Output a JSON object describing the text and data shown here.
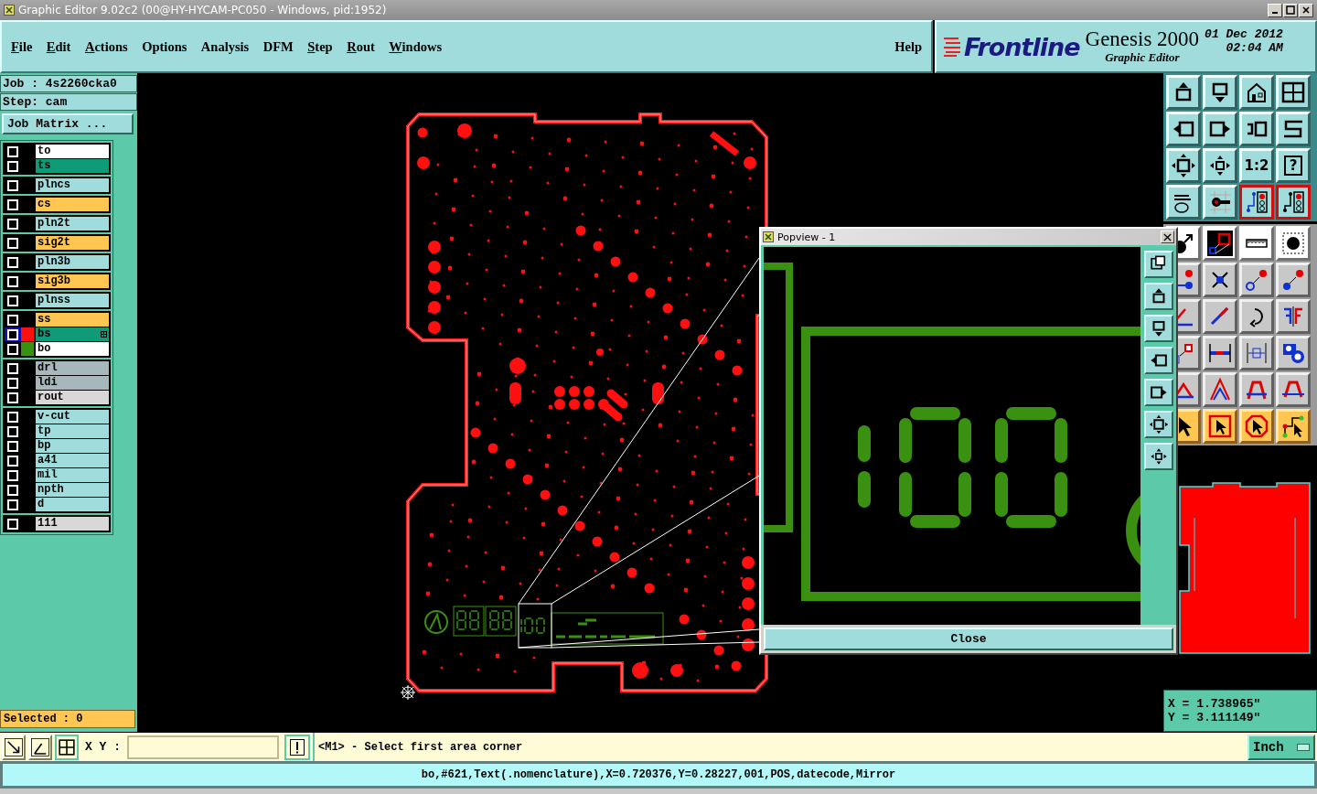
{
  "window": {
    "title": "Graphic Editor 9.02c2 (00@HY-HYCAM-PC050 - Windows, pid:1952)"
  },
  "menu": [
    {
      "label": "File",
      "underlined": true
    },
    {
      "label": "Edit",
      "underlined": true
    },
    {
      "label": "Actions",
      "underlined": true
    },
    {
      "label": "Options",
      "underlined": false
    },
    {
      "label": "Analysis",
      "underlined": false
    },
    {
      "label": "DFM",
      "underlined": false
    },
    {
      "label": "Step",
      "underlined": true
    },
    {
      "label": "Rout",
      "underlined": true
    },
    {
      "label": "Windows",
      "underlined": true
    }
  ],
  "help": "Help",
  "brand": {
    "logo": "Frontline",
    "product": "Genesis 2000",
    "subtitle": "Graphic Editor",
    "date": "01 Dec 2012",
    "time": "02:04 AM"
  },
  "job": {
    "job": "Job : 4s2260cka0",
    "step": "Step: cam",
    "matrix_button": "Job Matrix ..."
  },
  "layer_groups": [
    [
      {
        "name": "to",
        "color": "#ffffff",
        "checked": false,
        "selected": false
      },
      {
        "name": "ts",
        "color": "#0f9a78",
        "checked": false,
        "selected": false
      }
    ],
    [
      {
        "name": "plncs",
        "color": "#a0dcdc",
        "checked": false,
        "selected": false
      }
    ],
    [
      {
        "name": "cs",
        "color": "#ffc651",
        "checked": false,
        "selected": false
      }
    ],
    [
      {
        "name": "pln2t",
        "color": "#a0dcdc",
        "checked": false,
        "selected": false
      }
    ],
    [
      {
        "name": "sig2t",
        "color": "#ffc651",
        "checked": false,
        "selected": false
      }
    ],
    [
      {
        "name": "pln3b",
        "color": "#a0dcdc",
        "checked": false,
        "selected": false
      }
    ],
    [
      {
        "name": "sig3b",
        "color": "#ffc651",
        "checked": false,
        "selected": false
      }
    ],
    [
      {
        "name": "plnss",
        "color": "#a0dcdc",
        "checked": false,
        "selected": false
      }
    ],
    [
      {
        "name": "ss",
        "color": "#ffc651",
        "checked": false,
        "selected": false
      },
      {
        "name": "bs",
        "color": "#0f9a78",
        "checked": false,
        "selected": true,
        "swatch": {
          "color": "#ff1010"
        }
      },
      {
        "name": "bo",
        "color": "#ffffff",
        "checked": false,
        "selected": false,
        "swatch": {
          "color": "#3a9010"
        }
      }
    ],
    [
      {
        "name": "drl",
        "color": "#a6b8bc",
        "checked": false,
        "selected": false
      },
      {
        "name": "ldi",
        "color": "#a6b8bc",
        "checked": false,
        "selected": false
      },
      {
        "name": "rout",
        "color": "#d8d8d8",
        "checked": false,
        "selected": false
      }
    ],
    [
      {
        "name": "v-cut",
        "color": "#a0dcdc",
        "checked": false,
        "selected": false
      },
      {
        "name": "tp",
        "color": "#a0dcdc",
        "checked": false,
        "selected": false
      },
      {
        "name": "bp",
        "color": "#a0dcdc",
        "checked": false,
        "selected": false
      },
      {
        "name": "a41",
        "color": "#a0dcdc",
        "checked": false,
        "selected": false
      },
      {
        "name": "mil",
        "color": "#a0dcdc",
        "checked": false,
        "selected": false
      },
      {
        "name": "npth",
        "color": "#a0dcdc",
        "checked": false,
        "selected": false
      },
      {
        "name": "d",
        "color": "#a0dcdc",
        "checked": false,
        "selected": false
      }
    ],
    [
      {
        "name": "111",
        "color": "#d8d8d8",
        "checked": false,
        "selected": false
      }
    ]
  ],
  "selected_count": "Selected : 0",
  "tools": [
    {
      "kind": "view",
      "on": false
    },
    {
      "kind": "view",
      "on": false
    },
    {
      "kind": "view",
      "on": false
    },
    {
      "kind": "view",
      "on": false
    },
    {
      "kind": "view",
      "on": false
    },
    {
      "kind": "view",
      "on": false
    },
    {
      "kind": "view",
      "on": false
    },
    {
      "kind": "view",
      "on": false
    },
    {
      "kind": "view",
      "on": false
    },
    {
      "kind": "view",
      "on": false
    },
    {
      "kind": "view",
      "on": false,
      "label": "1:2"
    },
    {
      "kind": "view",
      "on": false,
      "label": "?"
    },
    {
      "kind": "view",
      "on": false
    },
    {
      "kind": "view",
      "on": false
    },
    {
      "kind": "view",
      "on": true
    },
    {
      "kind": "view",
      "on": true
    },
    {
      "kind": "display",
      "on": false
    },
    {
      "kind": "display",
      "on": false
    },
    {
      "kind": "display",
      "on": false
    },
    {
      "kind": "display",
      "on": false
    },
    {
      "kind": "edit",
      "on": false
    },
    {
      "kind": "edit",
      "on": false
    },
    {
      "kind": "edit",
      "on": false
    },
    {
      "kind": "edit",
      "on": false
    },
    {
      "kind": "edit",
      "on": false
    },
    {
      "kind": "edit",
      "on": false
    },
    {
      "kind": "edit",
      "on": false
    },
    {
      "kind": "edit",
      "on": false
    },
    {
      "kind": "edit",
      "on": false
    },
    {
      "kind": "edit",
      "on": false
    },
    {
      "kind": "edit",
      "on": false
    },
    {
      "kind": "edit",
      "on": false
    },
    {
      "kind": "edit",
      "on": false
    },
    {
      "kind": "edit",
      "on": false
    },
    {
      "kind": "edit",
      "on": false
    },
    {
      "kind": "edit",
      "on": false
    },
    {
      "kind": "select",
      "on": false
    },
    {
      "kind": "select",
      "on": false
    },
    {
      "kind": "select",
      "on": false
    },
    {
      "kind": "select",
      "on": false
    }
  ],
  "popview": {
    "title": "Popview - 1",
    "close": "Close"
  },
  "coords": {
    "x": "X = 1.738965\"",
    "y": "Y = 3.111149\""
  },
  "command": {
    "xy_label": "X Y :",
    "prompt": "<M1> - Select first area corner",
    "units": "Inch"
  },
  "status": "bo,#621,Text(.nomenclature),X=0.720376,Y=0.28227,001,POS,datecode,Mirror"
}
